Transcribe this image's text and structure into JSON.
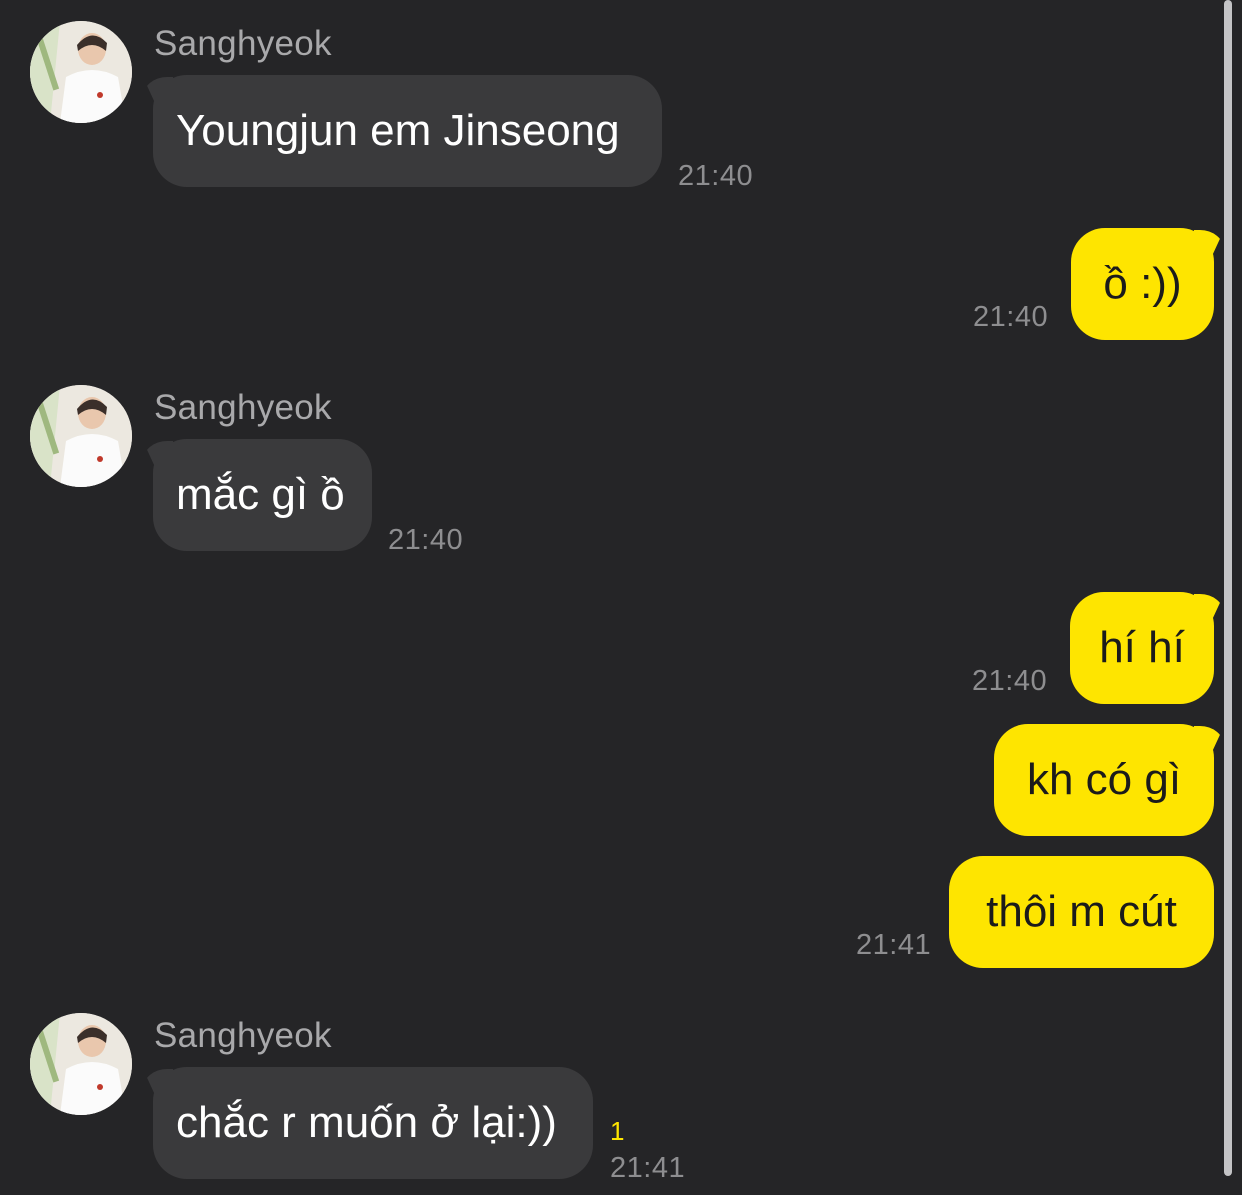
{
  "conversation": {
    "messages": [
      {
        "direction": "incoming",
        "sender": "Sanghyeok",
        "text": "Youngjun em Jinseong",
        "time": "21:40"
      },
      {
        "direction": "outgoing",
        "text": "ồ :))",
        "time": "21:40"
      },
      {
        "direction": "incoming",
        "sender": "Sanghyeok",
        "text": "mắc gì ồ",
        "time": "21:40"
      },
      {
        "direction": "outgoing",
        "text": "hí hí",
        "time": "21:40"
      },
      {
        "direction": "outgoing",
        "text": "kh có gì"
      },
      {
        "direction": "outgoing",
        "text": "thôi m cút",
        "time": "21:41"
      },
      {
        "direction": "incoming",
        "sender": "Sanghyeok",
        "text": "chắc r muốn ở lại:))",
        "time": "21:41",
        "unread_count": "1"
      }
    ]
  },
  "colors": {
    "background": "#252527",
    "incoming_bubble": "#3a3a3c",
    "outgoing_bubble": "#fee500",
    "unread_count": "#fee500"
  },
  "icons": {
    "avatar": "user-profile-photo"
  }
}
